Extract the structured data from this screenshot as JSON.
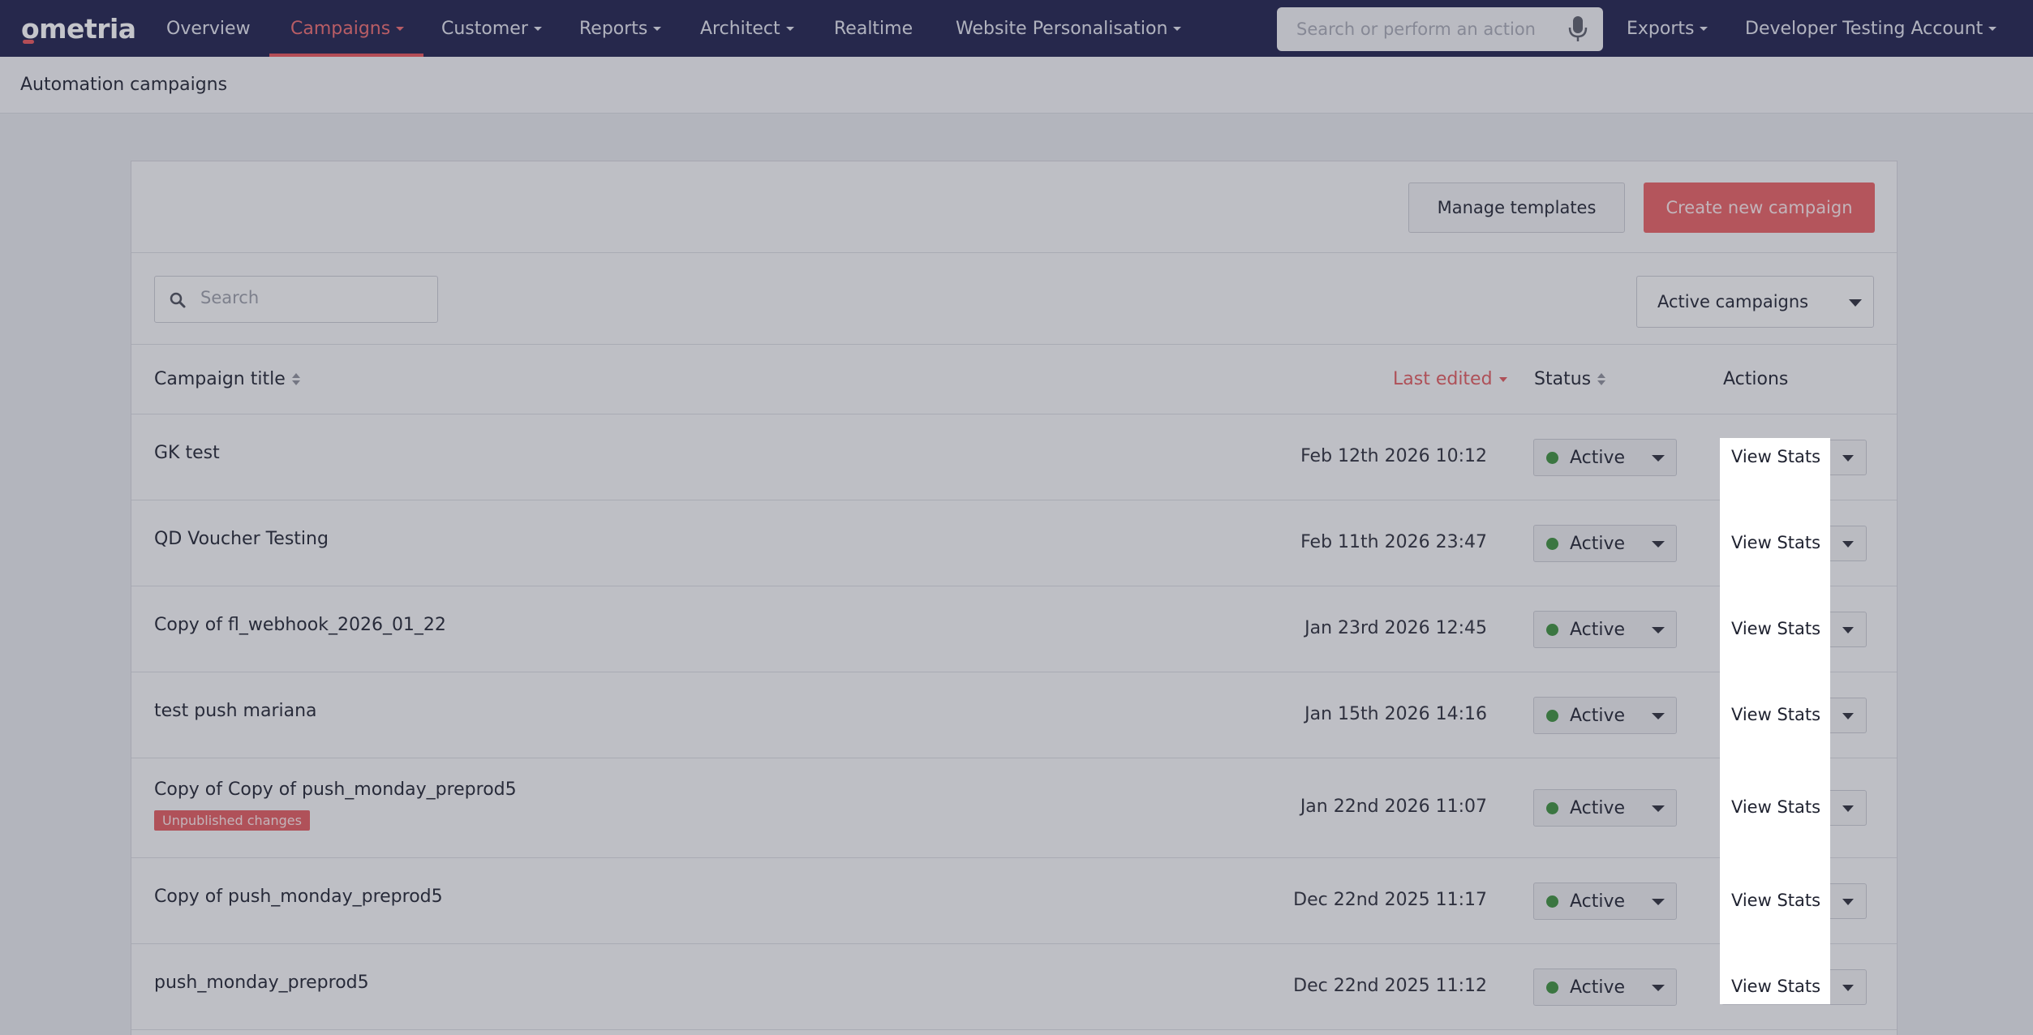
{
  "app": {
    "logo_text": "ometria"
  },
  "nav": {
    "items": [
      {
        "label": "Overview",
        "active": false,
        "caret": false
      },
      {
        "label": "Campaigns",
        "active": true,
        "caret": true
      },
      {
        "label": "Customer",
        "active": false,
        "caret": true
      },
      {
        "label": "Reports",
        "active": false,
        "caret": true
      },
      {
        "label": "Architect",
        "active": false,
        "caret": true
      },
      {
        "label": "Realtime",
        "active": false,
        "caret": false
      },
      {
        "label": "Website Personalisation",
        "active": false,
        "caret": true
      }
    ],
    "search_placeholder": "Search or perform an action",
    "exports_label": "Exports",
    "account_label": "Developer Testing Account"
  },
  "breadcrumb": {
    "title": "Automation campaigns"
  },
  "toolbar": {
    "manage_label": "Manage templates",
    "create_label": "Create new campaign"
  },
  "filters": {
    "search_placeholder": "Search",
    "status_filter": "Active campaigns"
  },
  "table": {
    "headers": {
      "title": "Campaign title",
      "last_edited": "Last edited",
      "status": "Status",
      "actions": "Actions"
    },
    "rows": [
      {
        "title": "GK test",
        "badge": "",
        "date": "Feb 12th 2026 10:12",
        "status": "Active",
        "action": "View Stats"
      },
      {
        "title": "QD Voucher Testing",
        "badge": "",
        "date": "Feb 11th 2026 23:47",
        "status": "Active",
        "action": "View Stats"
      },
      {
        "title": "Copy of fl_webhook_2026_01_22",
        "badge": "",
        "date": "Jan 23rd 2026 12:45",
        "status": "Active",
        "action": "View Stats"
      },
      {
        "title": "test push mariana",
        "badge": "",
        "date": "Jan 15th 2026 14:16",
        "status": "Active",
        "action": "View Stats"
      },
      {
        "title": "Copy of Copy of push_monday_preprod5",
        "badge": "Unpublished changes",
        "date": "Jan 22nd 2026 11:07",
        "status": "Active",
        "action": "View Stats"
      },
      {
        "title": "Copy of push_monday_preprod5",
        "badge": "",
        "date": "Dec 22nd 2025 11:17",
        "status": "Active",
        "action": "View Stats"
      },
      {
        "title": "push_monday_preprod5",
        "badge": "",
        "date": "Dec 22nd 2025 11:12",
        "status": "Active",
        "action": "View Stats"
      }
    ]
  },
  "colors": {
    "nav_bg": "#1e1f4b",
    "accent": "#e85f62",
    "status_active": "#3c8f3c"
  }
}
